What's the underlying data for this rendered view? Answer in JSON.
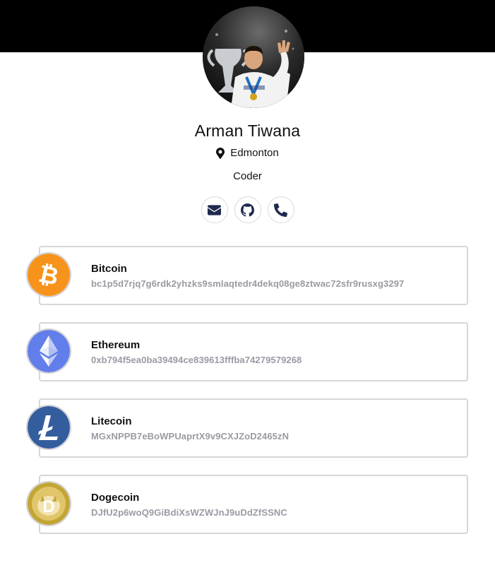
{
  "profile": {
    "name": "Arman Tiwana",
    "location": "Edmonton",
    "role": "Coder"
  },
  "socials": [
    {
      "icon": "envelope-icon"
    },
    {
      "icon": "github-icon"
    },
    {
      "icon": "phone-icon"
    }
  ],
  "wallets": [
    {
      "name": "Bitcoin",
      "address": "bc1p5d7rjq7g6rdk2yhzks9smlaqtedr4dekq08ge8ztwac72sfr9rusxg3297",
      "icon": "bitcoin-icon",
      "color": "#f7931a"
    },
    {
      "name": "Ethereum",
      "address": "0xb794f5ea0ba39494ce839613fffba74279579268",
      "icon": "ethereum-icon",
      "color": "#627eea"
    },
    {
      "name": "Litecoin",
      "address": "MGxNPPB7eBoWPUaprtX9v9CXJZoD2465zN",
      "icon": "litecoin-icon",
      "color": "#345d9d"
    },
    {
      "name": "Dogecoin",
      "address": "DJfU2p6woQ9GiBdiXsWZWJnJ9uDdZfSSNC",
      "icon": "dogecoin-icon",
      "color": "#c2a633"
    }
  ],
  "colors": {
    "header": "#000000",
    "social_icon": "#1f2a4d",
    "address_text": "#9a9aa3"
  }
}
